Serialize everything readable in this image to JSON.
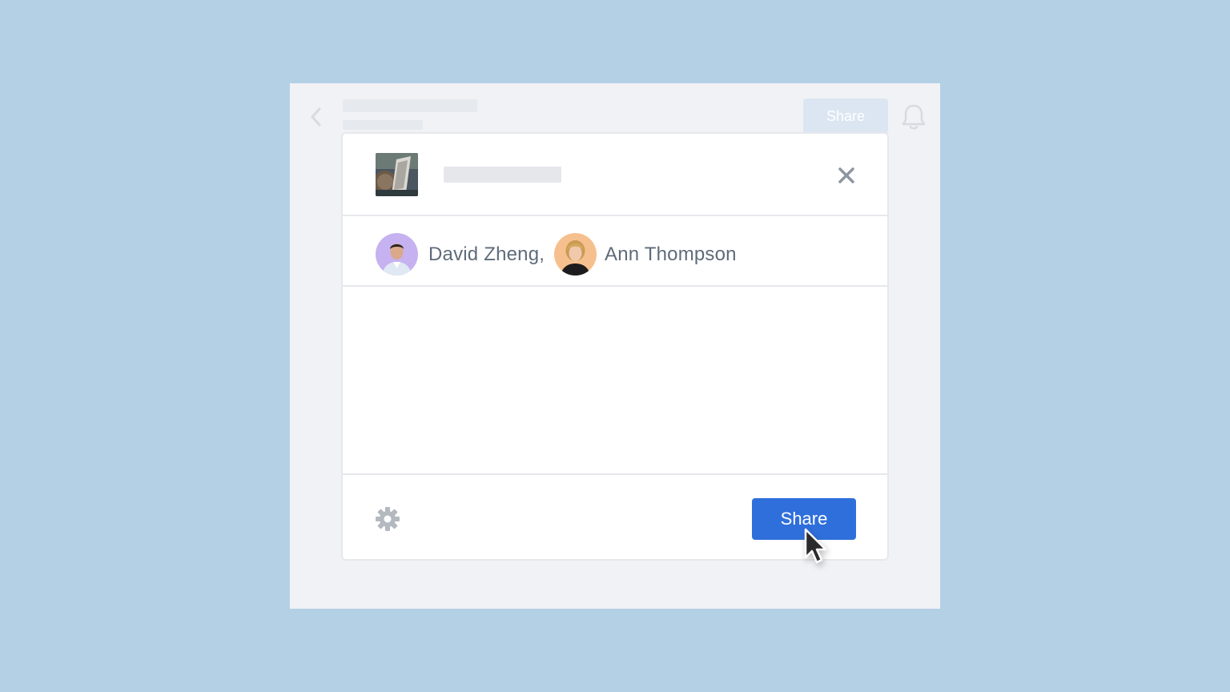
{
  "background_color": "#b4d0e5",
  "app": {
    "header": {
      "back_icon": "chevron-left-icon",
      "share_label": "Share",
      "notification_icon": "bell-icon"
    }
  },
  "share_dialog": {
    "file_thumbnail": "file-thumbnail-image",
    "close_icon": "close-icon",
    "recipients": [
      {
        "name": "David Zheng,",
        "avatar": "avatar-photo",
        "avatar_bg": "#c6b2f0"
      },
      {
        "name": "Ann Thompson",
        "avatar": "avatar-photo",
        "avatar_bg": "#f6c08e"
      }
    ],
    "message": "",
    "footer": {
      "settings_icon": "gear-icon",
      "share_label": "Share"
    }
  },
  "colors": {
    "primary_button": "#2f6fdb",
    "disabled_button": "#dbe6f2",
    "text_muted": "#5f6b7a"
  }
}
